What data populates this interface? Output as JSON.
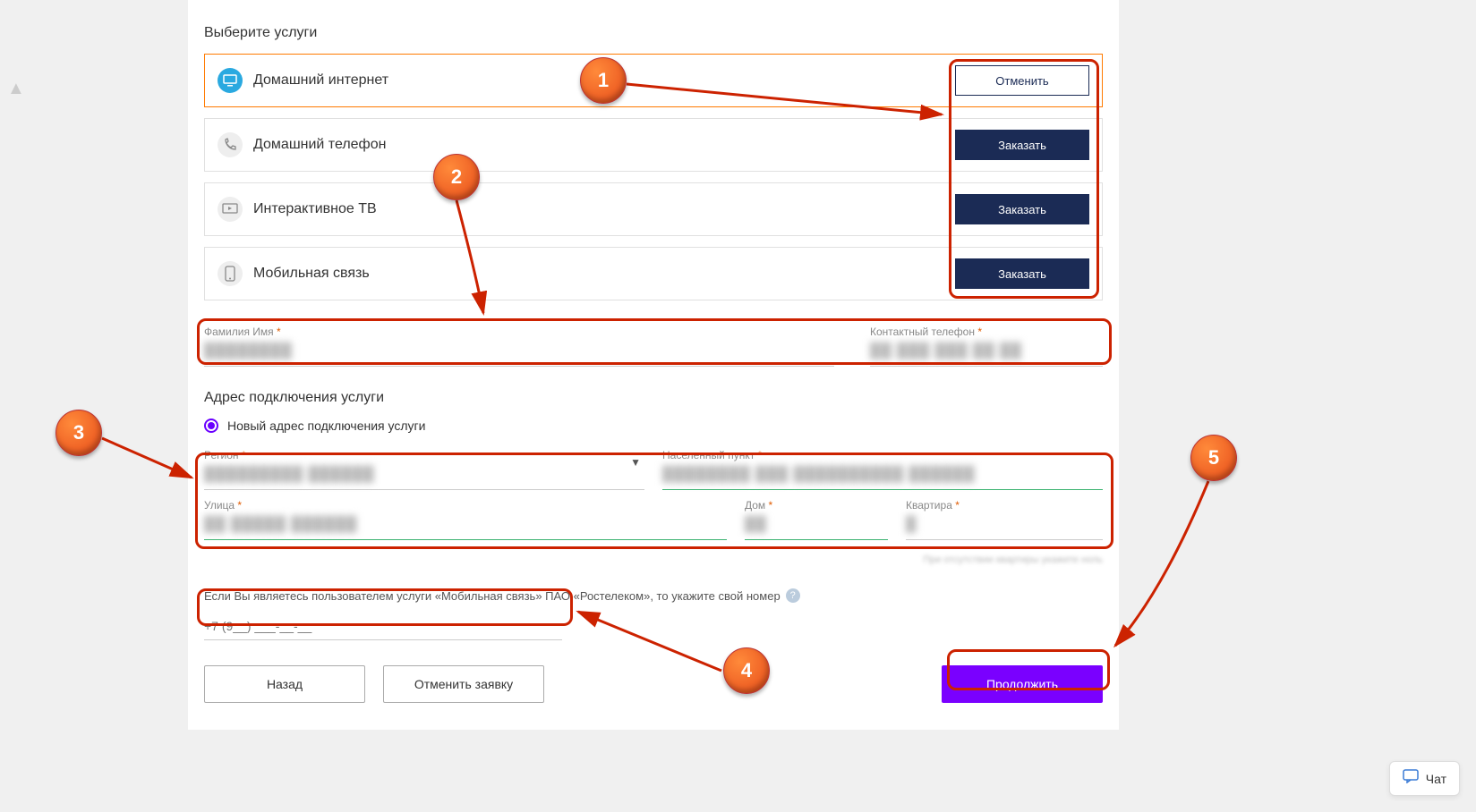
{
  "services_title": "Выберите услуги",
  "services": [
    {
      "name": "Домашний интернет",
      "icon": "monitor",
      "selected": true,
      "btn": "Отменить"
    },
    {
      "name": "Домашний телефон",
      "icon": "phone",
      "selected": false,
      "btn": "Заказать"
    },
    {
      "name": "Интерактивное ТВ",
      "icon": "tv",
      "selected": false,
      "btn": "Заказать"
    },
    {
      "name": "Мобильная связь",
      "icon": "mobile",
      "selected": false,
      "btn": "Заказать"
    }
  ],
  "person": {
    "name_label": "Фамилия Имя",
    "phone_label": "Контактный телефон"
  },
  "address_title": "Адрес подключения услуги",
  "address_radio": "Новый адрес подключения услуги",
  "address": {
    "region_label": "Регион",
    "city_label": "Населенный пункт",
    "street_label": "Улица",
    "house_label": "Дом",
    "apt_label": "Квартира",
    "apt_hint": "При отсутствии квартиры укажите ноль"
  },
  "mobile_hint": "Если Вы являетесь пользователем услуги «Мобильная связь» ПАО «Ростелеком», то укажите свой номер",
  "phone_placeholder": "+7 (9__) ___-__-__",
  "buttons": {
    "back": "Назад",
    "cancel_request": "Отменить заявку",
    "continue": "Продолжить"
  },
  "chat_label": "Чат",
  "callouts": [
    "1",
    "2",
    "3",
    "4",
    "5"
  ]
}
